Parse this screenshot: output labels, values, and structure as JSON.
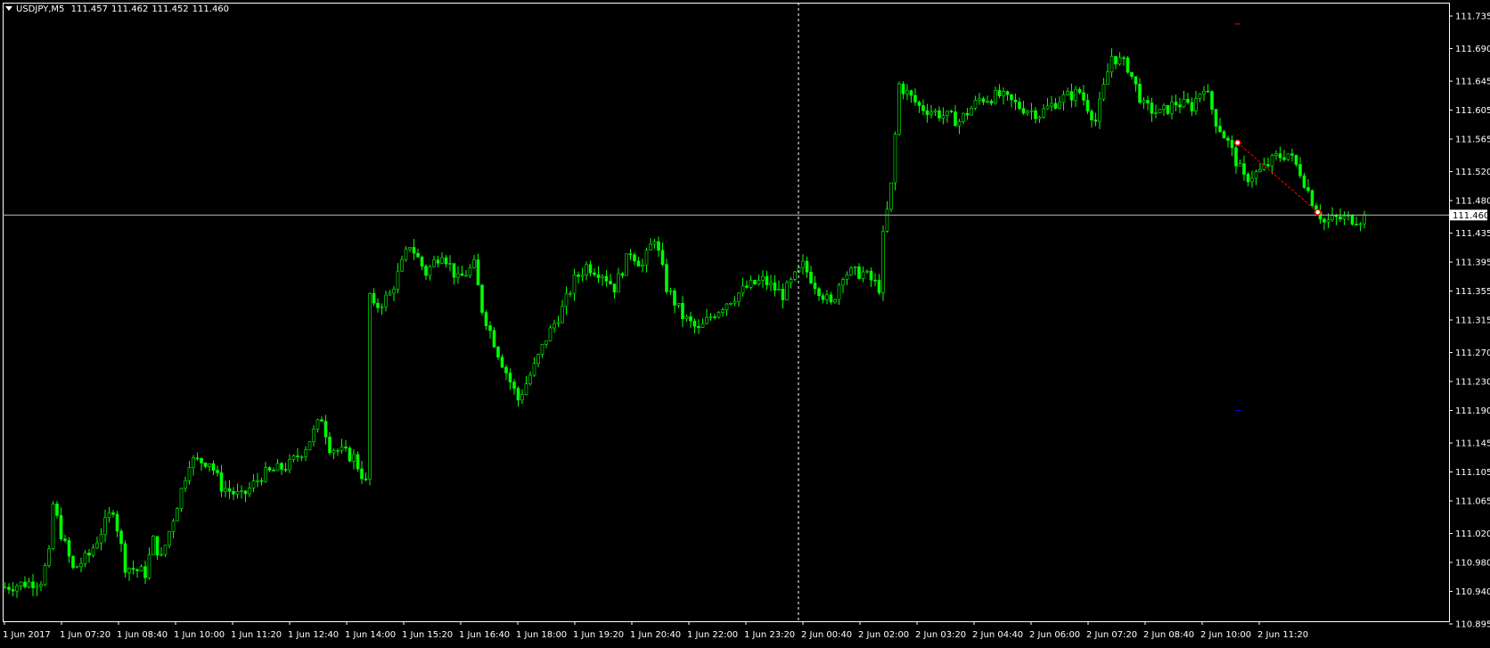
{
  "header": {
    "symbol": "USDJPY,M5",
    "open": "111.457",
    "high": "111.462",
    "low": "111.452",
    "close": "111.460"
  },
  "colors": {
    "background": "#000000",
    "frame": "#ffffff",
    "candle": "#00ff00",
    "bid_line": "#c0c0c0",
    "trade_line": "#ff0000",
    "stop_marker": "#0000ff"
  },
  "chart_data": {
    "type": "candlestick",
    "symbol": "USDJPY",
    "timeframe": "M5",
    "ylim": [
      110.895,
      111.735
    ],
    "y_ticks": [
      "111.735",
      "111.690",
      "111.645",
      "111.605",
      "111.565",
      "111.520",
      "111.480",
      "111.435",
      "111.395",
      "111.355",
      "111.315",
      "111.270",
      "111.230",
      "111.190",
      "111.145",
      "111.105",
      "111.065",
      "111.020",
      "110.980",
      "110.940",
      "110.895"
    ],
    "x_ticks": [
      "1 Jun 2017",
      "1 Jun 07:20",
      "1 Jun 08:40",
      "1 Jun 10:00",
      "1 Jun 11:20",
      "1 Jun 12:40",
      "1 Jun 14:00",
      "1 Jun 15:20",
      "1 Jun 16:40",
      "1 Jun 18:00",
      "1 Jun 19:20",
      "1 Jun 20:40",
      "1 Jun 22:00",
      "1 Jun 23:20",
      "2 Jun 00:40",
      "2 Jun 02:00",
      "2 Jun 03:20",
      "2 Jun 04:40",
      "2 Jun 06:00",
      "2 Jun 07:20",
      "2 Jun 08:40",
      "2 Jun 10:00",
      "2 Jun 11:20"
    ],
    "bid": 111.46,
    "bid_label": "111.460",
    "grid": false,
    "candle_count": 340,
    "price_path": [
      [
        0,
        110.945
      ],
      [
        10,
        110.955
      ],
      [
        12,
        110.99
      ],
      [
        13,
        111.06
      ],
      [
        15,
        111.02
      ],
      [
        18,
        110.97
      ],
      [
        22,
        110.99
      ],
      [
        28,
        111.055
      ],
      [
        31,
        110.975
      ],
      [
        36,
        110.965
      ],
      [
        38,
        111.01
      ],
      [
        40,
        110.985
      ],
      [
        45,
        111.08
      ],
      [
        47,
        111.12
      ],
      [
        52,
        111.12
      ],
      [
        55,
        111.085
      ],
      [
        60,
        111.07
      ],
      [
        65,
        111.1
      ],
      [
        72,
        111.115
      ],
      [
        76,
        111.14
      ],
      [
        80,
        111.18
      ],
      [
        82,
        111.14
      ],
      [
        88,
        111.125
      ],
      [
        91,
        111.09
      ],
      [
        91.5,
        111.36
      ],
      [
        93,
        111.33
      ],
      [
        97,
        111.35
      ],
      [
        102,
        111.42
      ],
      [
        106,
        111.38
      ],
      [
        110,
        111.41
      ],
      [
        114,
        111.37
      ],
      [
        118,
        111.39
      ],
      [
        120,
        111.33
      ],
      [
        124,
        111.27
      ],
      [
        127,
        111.23
      ],
      [
        129,
        111.205
      ],
      [
        133,
        111.25
      ],
      [
        136,
        111.29
      ],
      [
        140,
        111.33
      ],
      [
        143,
        111.37
      ],
      [
        146,
        111.39
      ],
      [
        150,
        111.38
      ],
      [
        153,
        111.36
      ],
      [
        157,
        111.41
      ],
      [
        160,
        111.39
      ],
      [
        163,
        111.43
      ],
      [
        166,
        111.36
      ],
      [
        170,
        111.32
      ],
      [
        174,
        111.3
      ],
      [
        177,
        111.32
      ],
      [
        181,
        111.34
      ],
      [
        186,
        111.36
      ],
      [
        190,
        111.37
      ],
      [
        195,
        111.35
      ],
      [
        200,
        111.39
      ],
      [
        203,
        111.365
      ],
      [
        207,
        111.335
      ],
      [
        210,
        111.38
      ],
      [
        215,
        111.38
      ],
      [
        219,
        111.36
      ],
      [
        220,
        111.43
      ],
      [
        222,
        111.5
      ],
      [
        224,
        111.64
      ],
      [
        229,
        111.61
      ],
      [
        234,
        111.6
      ],
      [
        239,
        111.59
      ],
      [
        244,
        111.62
      ],
      [
        249,
        111.625
      ],
      [
        254,
        111.61
      ],
      [
        259,
        111.6
      ],
      [
        264,
        111.62
      ],
      [
        269,
        111.63
      ],
      [
        273,
        111.59
      ],
      [
        277,
        111.68
      ],
      [
        281,
        111.665
      ],
      [
        285,
        111.61
      ],
      [
        289,
        111.6
      ],
      [
        293,
        111.615
      ],
      [
        297,
        111.61
      ],
      [
        300,
        111.64
      ],
      [
        303,
        111.59
      ],
      [
        306,
        111.56
      ],
      [
        310,
        111.51
      ],
      [
        314,
        111.52
      ],
      [
        318,
        111.54
      ],
      [
        321,
        111.545
      ],
      [
        324,
        111.52
      ],
      [
        327,
        111.48
      ],
      [
        330,
        111.45
      ],
      [
        333,
        111.455
      ]
    ],
    "trade": {
      "entry_price": 111.56,
      "entry_candle": 307.5,
      "exit_price": 111.464,
      "exit_candle": 327.5,
      "take_profit": 111.724,
      "stop_loss": 111.19
    },
    "crosshair_candle": 198
  }
}
